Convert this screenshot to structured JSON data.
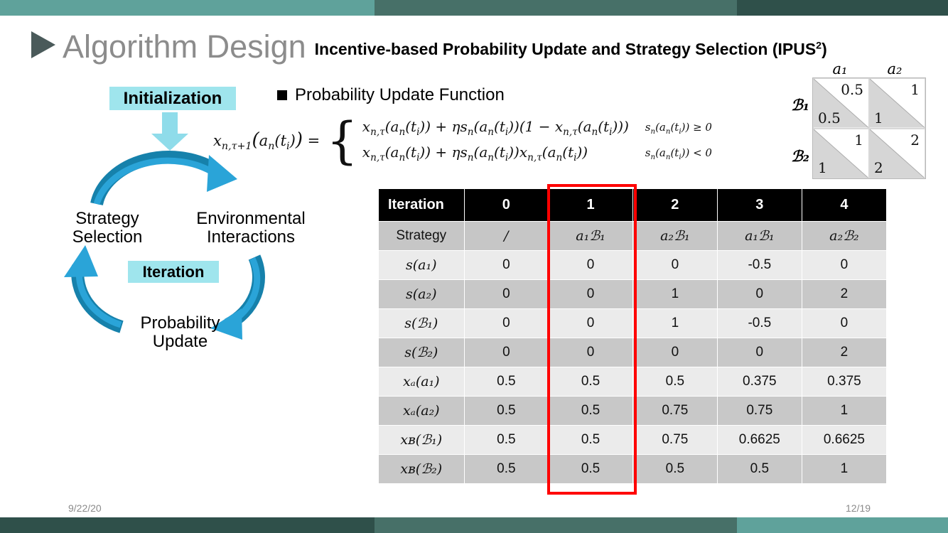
{
  "theme": {
    "bar_light": "#5fa29b",
    "bar_mid": "#477068",
    "bar_dark": "#2f504a",
    "highlight_cyan": "#9fe5ed",
    "arrow_blue": "#1f9ad6",
    "arrow_blue_dark": "#1681ab",
    "red_box": "#ff0000",
    "title_gray": "#8c8c8c"
  },
  "header": {
    "title": "Algorithm Design",
    "subtitle_text": "Incentive-based Probability Update and Strategy Selection (IPUS",
    "subtitle_sup": "2",
    "subtitle_tail": ")"
  },
  "cycle": {
    "init_label": "Initialization",
    "iteration_label": "Iteration",
    "strategy_label": "Strategy\nSelection",
    "strategy_line1": "Strategy",
    "strategy_line2": "Selection",
    "environment_line1": "Environmental",
    "environment_line2": "Interactions",
    "probability_line1": "Probability",
    "probability_line2": "Update"
  },
  "bullet": {
    "label": "Probability Update Function"
  },
  "formula": {
    "lhs": "x_{n,τ+1}(a_n(t_i)) =",
    "case1_body": "x_{n,τ}(a_n(t_i)) + ηs_n(a_n(t_i))(1 − x_{n,τ}(a_n(t_i)))",
    "case1_cond": "s_n(a_n(t_i)) ≥ 0",
    "case2_body": "x_{n,τ}(a_n(t_i)) + ηs_n(a_n(t_i))x_{n,τ}(a_n(t_i))",
    "case2_cond": "s_n(a_n(t_i)) < 0"
  },
  "payoff": {
    "col_headers": [
      "a₁",
      "a₂"
    ],
    "row_headers": [
      "ℬ₁",
      "ℬ₂"
    ],
    "cells": [
      [
        {
          "top": "0.5",
          "bottom": "0.5"
        },
        {
          "top": "1",
          "bottom": "1"
        }
      ],
      [
        {
          "top": "1",
          "bottom": "1"
        },
        {
          "top": "2",
          "bottom": "2"
        }
      ]
    ]
  },
  "table": {
    "header": [
      "Iteration",
      "0",
      "1",
      "2",
      "3",
      "4"
    ],
    "highlight_column_index": 2,
    "rows": [
      {
        "label": "Strategy",
        "label_type": "text",
        "values": [
          "/",
          "a₁ℬ₁",
          "a₂ℬ₁",
          "a₁ℬ₁",
          "a₂ℬ₂"
        ],
        "value_type": "math"
      },
      {
        "label": "s(a₁)",
        "label_type": "math",
        "values": [
          "0",
          "0",
          "0",
          "-0.5",
          "0"
        ],
        "value_type": "text"
      },
      {
        "label": "s(a₂)",
        "label_type": "math",
        "values": [
          "0",
          "0",
          "1",
          "0",
          "2"
        ],
        "value_type": "text"
      },
      {
        "label": "s(ℬ₁)",
        "label_type": "math",
        "values": [
          "0",
          "0",
          "1",
          "-0.5",
          "0"
        ],
        "value_type": "text"
      },
      {
        "label": "s(ℬ₂)",
        "label_type": "math",
        "values": [
          "0",
          "0",
          "0",
          "0",
          "2"
        ],
        "value_type": "text"
      },
      {
        "label": "xₐ(a₁)",
        "label_type": "math",
        "values": [
          "0.5",
          "0.5",
          "0.5",
          "0.375",
          "0.375"
        ],
        "value_type": "text"
      },
      {
        "label": "xₐ(a₂)",
        "label_type": "math",
        "values": [
          "0.5",
          "0.5",
          "0.75",
          "0.75",
          "1"
        ],
        "value_type": "text"
      },
      {
        "label": "xʙ(ℬ₁)",
        "label_type": "math",
        "values": [
          "0.5",
          "0.5",
          "0.75",
          "0.6625",
          "0.6625"
        ],
        "value_type": "text"
      },
      {
        "label": "xʙ(ℬ₂)",
        "label_type": "math",
        "values": [
          "0.5",
          "0.5",
          "0.5",
          "0.5",
          "1"
        ],
        "value_type": "text"
      }
    ]
  },
  "footer": {
    "date": "9/22/20",
    "page": "12/19"
  }
}
